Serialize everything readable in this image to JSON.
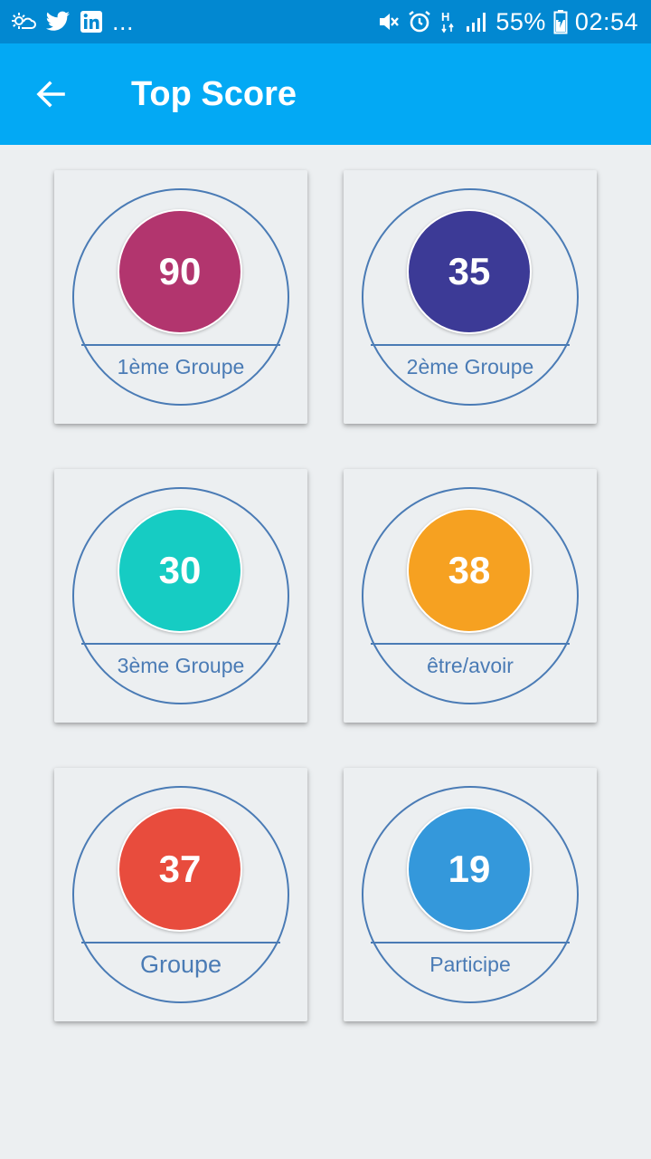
{
  "status_bar": {
    "ellipsis": "...",
    "battery_percent": "55%",
    "time": "02:54",
    "network": "H",
    "icons": [
      "weather-icon",
      "twitter-icon",
      "linkedin-icon",
      "mute-icon",
      "alarm-icon",
      "signal-icon",
      "battery-charging-icon"
    ]
  },
  "app_bar": {
    "title": "Top Score",
    "back_icon": "arrow-left-icon"
  },
  "colors": {
    "status_bar": "#0288D1",
    "app_bar": "#03A9F4",
    "ring": "#4A7BB5",
    "background": "#ECEFF1"
  },
  "cards": [
    {
      "score": "90",
      "label": "1ème Groupe",
      "color": "#B2356E"
    },
    {
      "score": "35",
      "label": "2ème Groupe",
      "color": "#3C3A96"
    },
    {
      "score": "30",
      "label": "3ème Groupe",
      "color": "#16CCC3"
    },
    {
      "score": "38",
      "label": "être/avoir",
      "color": "#F6A121"
    },
    {
      "score": "37",
      "label": "Groupe",
      "color": "#E84C3D"
    },
    {
      "score": "19",
      "label": "Participe",
      "color": "#3498DB"
    }
  ]
}
